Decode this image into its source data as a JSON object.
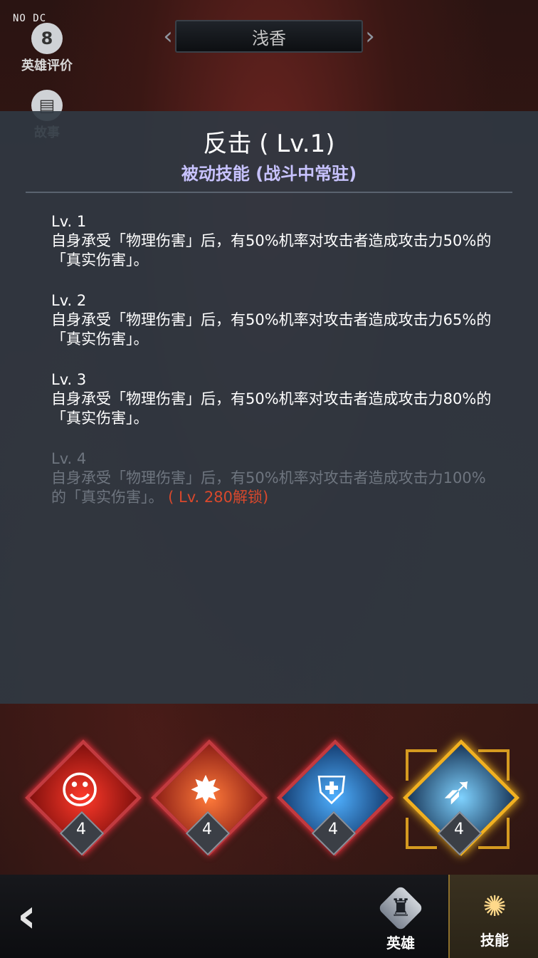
{
  "debug_tag": "NO DC",
  "header": {
    "hero_name": "浅香",
    "prev_icon": "chevron-left-icon",
    "next_icon": "chevron-right-icon"
  },
  "side_buttons": [
    {
      "label": "英雄评价",
      "icon": "chat-bubble-icon"
    },
    {
      "label": "故事",
      "icon": "book-icon"
    }
  ],
  "skill_detail": {
    "title": "反击 ( Lv.1)",
    "subtitle": "被动技能 (战斗中常驻)",
    "levels": [
      {
        "level": "Lv. 1",
        "desc": "自身承受「物理伤害」后，有50%机率对攻击者造成攻击力50%的「真实伤害」。",
        "locked": false,
        "lock_note": ""
      },
      {
        "level": "Lv. 2",
        "desc": "自身承受「物理伤害」后，有50%机率对攻击者造成攻击力65%的「真实伤害」。",
        "locked": false,
        "lock_note": ""
      },
      {
        "level": "Lv. 3",
        "desc": "自身承受「物理伤害」后，有50%机率对攻击者造成攻击力80%的「真实伤害」。",
        "locked": false,
        "lock_note": ""
      },
      {
        "level": "Lv. 4",
        "desc": "自身承受「物理伤害」后，有50%机率对攻击者造成攻击力100%的「真实伤害」。",
        "locked": true,
        "lock_note": " ( Lv. 280解锁)"
      }
    ]
  },
  "skills": [
    {
      "name": "skill-provoke",
      "icon": "fury-figure-icon",
      "level": "4",
      "selected": false,
      "color": "#d21a1a"
    },
    {
      "name": "skill-spiked-club",
      "icon": "spiked-club-icon",
      "level": "4",
      "selected": false,
      "color": "#d8322a"
    },
    {
      "name": "skill-shield-sword",
      "icon": "shield-sword-icon",
      "level": "4",
      "selected": false,
      "color": "#1b6fc8"
    },
    {
      "name": "skill-counter",
      "icon": "blade-slash-icon",
      "level": "4",
      "selected": true,
      "color": "#2aa0ff"
    }
  ],
  "bottom_nav": {
    "back_icon": "back-arrow-icon",
    "tabs": [
      {
        "label": "英雄",
        "icon": "knight-helmet-icon",
        "active": false
      },
      {
        "label": "技能",
        "icon": "skill-burst-icon",
        "active": true
      }
    ]
  },
  "colors": {
    "panel": "#303842",
    "subtitle": "#c8c3ff",
    "lock_note": "#d9482c",
    "selected_frame": "#f0b021",
    "unselected_frame": "#c23a3f"
  }
}
